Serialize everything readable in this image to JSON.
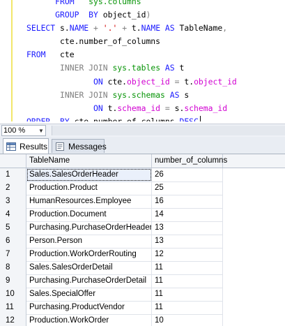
{
  "editor": {
    "lines": [
      [
        {
          "t": "      ",
          "c": ""
        },
        {
          "t": "FROM",
          "c": "kw"
        },
        {
          "t": "   ",
          "c": ""
        },
        {
          "t": "sys.columns",
          "c": "sys"
        }
      ],
      [
        {
          "t": "      ",
          "c": ""
        },
        {
          "t": "GROUP",
          "c": "kw"
        },
        {
          "t": "  ",
          "c": ""
        },
        {
          "t": "BY",
          "c": "kw"
        },
        {
          "t": " object_id",
          "c": ""
        },
        {
          "t": ")",
          "c": "op"
        }
      ],
      [
        {
          "t": "SELECT",
          "c": "kw"
        },
        {
          "t": " s.",
          "c": ""
        },
        {
          "t": "NAME",
          "c": "kw"
        },
        {
          "t": " ",
          "c": ""
        },
        {
          "t": "+",
          "c": "op"
        },
        {
          "t": " ",
          "c": ""
        },
        {
          "t": "'.'",
          "c": "str"
        },
        {
          "t": " ",
          "c": ""
        },
        {
          "t": "+",
          "c": "op"
        },
        {
          "t": " t.",
          "c": ""
        },
        {
          "t": "NAME",
          "c": "kw"
        },
        {
          "t": " ",
          "c": ""
        },
        {
          "t": "AS",
          "c": "kw"
        },
        {
          "t": " TableName",
          "c": ""
        },
        {
          "t": ",",
          "c": "op"
        }
      ],
      [
        {
          "t": "       cte.number_of_columns",
          "c": ""
        }
      ],
      [
        {
          "t": "FROM",
          "c": "kw"
        },
        {
          "t": "   cte",
          "c": ""
        }
      ],
      [
        {
          "t": "       ",
          "c": ""
        },
        {
          "t": "INNER",
          "c": "op"
        },
        {
          "t": " ",
          "c": ""
        },
        {
          "t": "JOIN",
          "c": "op"
        },
        {
          "t": " ",
          "c": ""
        },
        {
          "t": "sys.tables",
          "c": "sys"
        },
        {
          "t": " ",
          "c": ""
        },
        {
          "t": "AS",
          "c": "kw"
        },
        {
          "t": " t",
          "c": ""
        }
      ],
      [
        {
          "t": "              ",
          "c": ""
        },
        {
          "t": "ON",
          "c": "kw"
        },
        {
          "t": " cte.",
          "c": ""
        },
        {
          "t": "object_id",
          "c": "fn"
        },
        {
          "t": " ",
          "c": ""
        },
        {
          "t": "=",
          "c": "op"
        },
        {
          "t": " t.",
          "c": ""
        },
        {
          "t": "object_id",
          "c": "fn"
        }
      ],
      [
        {
          "t": "       ",
          "c": ""
        },
        {
          "t": "INNER",
          "c": "op"
        },
        {
          "t": " ",
          "c": ""
        },
        {
          "t": "JOIN",
          "c": "op"
        },
        {
          "t": " ",
          "c": ""
        },
        {
          "t": "sys.schemas",
          "c": "sys"
        },
        {
          "t": " ",
          "c": ""
        },
        {
          "t": "AS",
          "c": "kw"
        },
        {
          "t": " s",
          "c": ""
        }
      ],
      [
        {
          "t": "              ",
          "c": ""
        },
        {
          "t": "ON",
          "c": "kw"
        },
        {
          "t": " t.",
          "c": ""
        },
        {
          "t": "schema_id",
          "c": "fn"
        },
        {
          "t": " ",
          "c": ""
        },
        {
          "t": "=",
          "c": "op"
        },
        {
          "t": " s.",
          "c": ""
        },
        {
          "t": "schema_id",
          "c": "fn"
        }
      ],
      [
        {
          "t": "ORDER",
          "c": "kw"
        },
        {
          "t": "  ",
          "c": ""
        },
        {
          "t": "BY",
          "c": "kw"
        },
        {
          "t": " cte.number_of_columns ",
          "c": ""
        },
        {
          "t": "DESC",
          "c": "kw"
        }
      ]
    ]
  },
  "zoom": {
    "value": "100 %",
    "arrow_icon": "chevron-down-icon"
  },
  "tabs": [
    {
      "label": "Results",
      "icon": "grid-icon"
    },
    {
      "label": "Messages",
      "icon": "messages-icon"
    }
  ],
  "grid": {
    "columns": [
      "TableName",
      "number_of_columns"
    ],
    "rows": [
      [
        "1",
        "Sales.SalesOrderHeader",
        "26"
      ],
      [
        "2",
        "Production.Product",
        "25"
      ],
      [
        "3",
        "HumanResources.Employee",
        "16"
      ],
      [
        "4",
        "Production.Document",
        "14"
      ],
      [
        "5",
        "Purchasing.PurchaseOrderHeader",
        "13"
      ],
      [
        "6",
        "Person.Person",
        "13"
      ],
      [
        "7",
        "Production.WorkOrderRouting",
        "12"
      ],
      [
        "8",
        "Sales.SalesOrderDetail",
        "11"
      ],
      [
        "9",
        "Purchasing.PurchaseOrderDetail",
        "11"
      ],
      [
        "10",
        "Sales.SpecialOffer",
        "11"
      ],
      [
        "11",
        "Purchasing.ProductVendor",
        "11"
      ],
      [
        "12",
        "Production.WorkOrder",
        "10"
      ]
    ]
  }
}
